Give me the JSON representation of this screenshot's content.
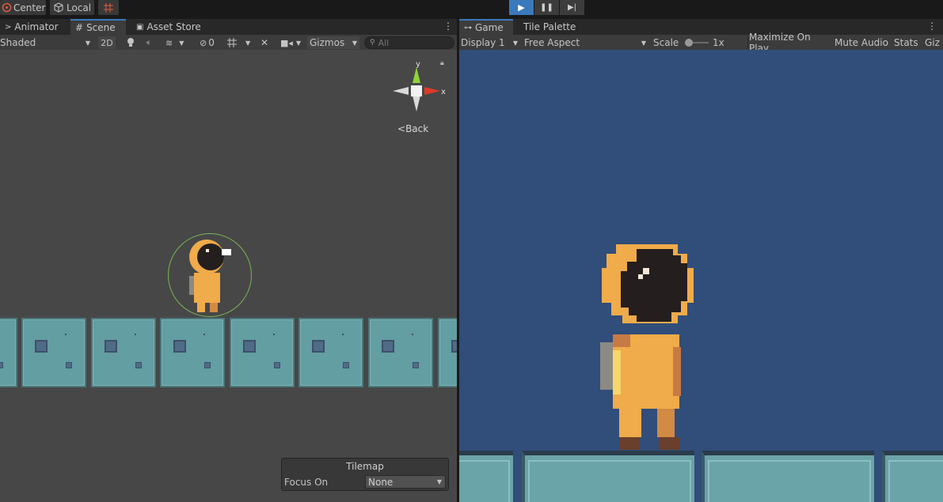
{
  "toolbar": {
    "pivot_label": "Center",
    "space_label": "Local"
  },
  "scene_panel": {
    "tabs": [
      "Animator",
      "Scene",
      "Asset Store"
    ],
    "shading_mode": "Shaded",
    "mode_2d": "2D",
    "hidden_count": "0",
    "gizmos_label": "Gizmos",
    "search_placeholder": "All",
    "back_label": "Back",
    "axis_y": "y",
    "axis_x": "x"
  },
  "game_panel": {
    "tabs": [
      "Game",
      "Tile Palette"
    ],
    "display": "Display 1",
    "aspect": "Free Aspect",
    "scale_label": "Scale",
    "scale_value": "1x",
    "maximize_label": "Maximize On Play",
    "mute_label": "Mute Audio",
    "stats_label": "Stats",
    "gizmos_truncated": "Giz"
  },
  "tilemap_overlay": {
    "title": "Tilemap",
    "focus_label": "Focus On",
    "focus_value": "None"
  },
  "colors": {
    "scene_bg": "#474747",
    "game_bg": "#314d7a",
    "tile": "#639ea2",
    "character": "#f0ab4a",
    "accent": "#3a79bb"
  }
}
